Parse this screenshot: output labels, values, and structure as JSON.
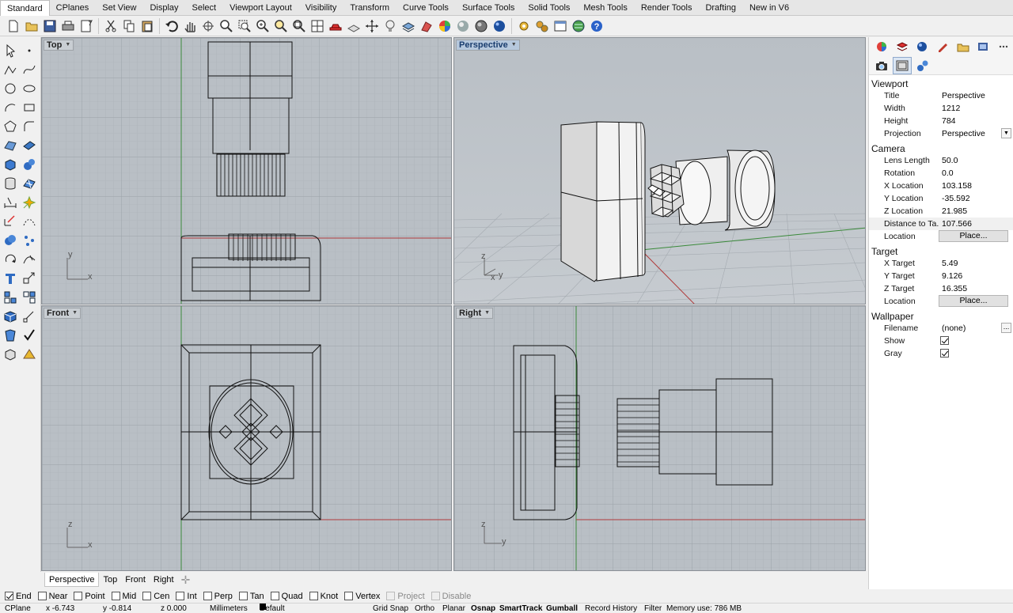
{
  "menu_tabs": [
    "Standard",
    "CPlanes",
    "Set View",
    "Display",
    "Select",
    "Viewport Layout",
    "Visibility",
    "Transform",
    "Curve Tools",
    "Surface Tools",
    "Solid Tools",
    "Mesh Tools",
    "Render Tools",
    "Drafting",
    "New in V6"
  ],
  "active_menu_tab": "Standard",
  "viewports": {
    "top": {
      "label": "Top",
      "axis_a": "y",
      "axis_b": "x"
    },
    "perspective": {
      "label": "Perspective",
      "axis_a": "z",
      "axis_b": "x",
      "axis_c": "y"
    },
    "front": {
      "label": "Front",
      "axis_a": "z",
      "axis_b": "x"
    },
    "right": {
      "label": "Right",
      "axis_a": "z",
      "axis_b": "y"
    }
  },
  "viewport_tabs": [
    "Perspective",
    "Top",
    "Front",
    "Right"
  ],
  "osnaps": [
    {
      "label": "End",
      "checked": true
    },
    {
      "label": "Near",
      "checked": false
    },
    {
      "label": "Point",
      "checked": false
    },
    {
      "label": "Mid",
      "checked": false
    },
    {
      "label": "Cen",
      "checked": false
    },
    {
      "label": "Int",
      "checked": false
    },
    {
      "label": "Perp",
      "checked": false
    },
    {
      "label": "Tan",
      "checked": false
    },
    {
      "label": "Quad",
      "checked": false
    },
    {
      "label": "Knot",
      "checked": false
    },
    {
      "label": "Vertex",
      "checked": false
    },
    {
      "label": "Project",
      "checked": false,
      "disabled": true
    },
    {
      "label": "Disable",
      "checked": false,
      "disabled": true
    }
  ],
  "status": {
    "cplane": "CPlane",
    "x": "x -6.743",
    "y": "y -0.814",
    "z": "z 0.000",
    "units": "Millimeters",
    "layer": "Default",
    "grid_snap": "Grid Snap",
    "ortho": "Ortho",
    "planar": "Planar",
    "osnap": "Osnap",
    "smarttrack": "SmartTrack",
    "gumball": "Gumball",
    "record_history": "Record History",
    "filter": "Filter",
    "memory": "Memory use: 786 MB"
  },
  "panel": {
    "viewport_section": "Viewport",
    "viewport_rows": [
      {
        "key": "Title",
        "value": "Perspective"
      },
      {
        "key": "Width",
        "value": "1212"
      },
      {
        "key": "Height",
        "value": "784"
      },
      {
        "key": "Projection",
        "value": "Perspective"
      }
    ],
    "camera_section": "Camera",
    "camera_rows": [
      {
        "key": "Lens Length",
        "value": "50.0"
      },
      {
        "key": "Rotation",
        "value": "0.0"
      },
      {
        "key": "X Location",
        "value": "103.158"
      },
      {
        "key": "Y Location",
        "value": "-35.592"
      },
      {
        "key": "Z Location",
        "value": "21.985"
      },
      {
        "key": "Distance to Ta...",
        "value": "107.566"
      },
      {
        "key": "Location",
        "value": "Place..."
      }
    ],
    "target_section": "Target",
    "target_rows": [
      {
        "key": "X Target",
        "value": "5.49"
      },
      {
        "key": "Y Target",
        "value": "9.126"
      },
      {
        "key": "Z Target",
        "value": "16.355"
      },
      {
        "key": "Location",
        "value": "Place..."
      }
    ],
    "wallpaper_section": "Wallpaper",
    "wallpaper_rows": [
      {
        "key": "Filename",
        "value": "(none)"
      },
      {
        "key": "Show",
        "value": "",
        "checked": true
      },
      {
        "key": "Gray",
        "value": "",
        "checked": true
      }
    ]
  }
}
